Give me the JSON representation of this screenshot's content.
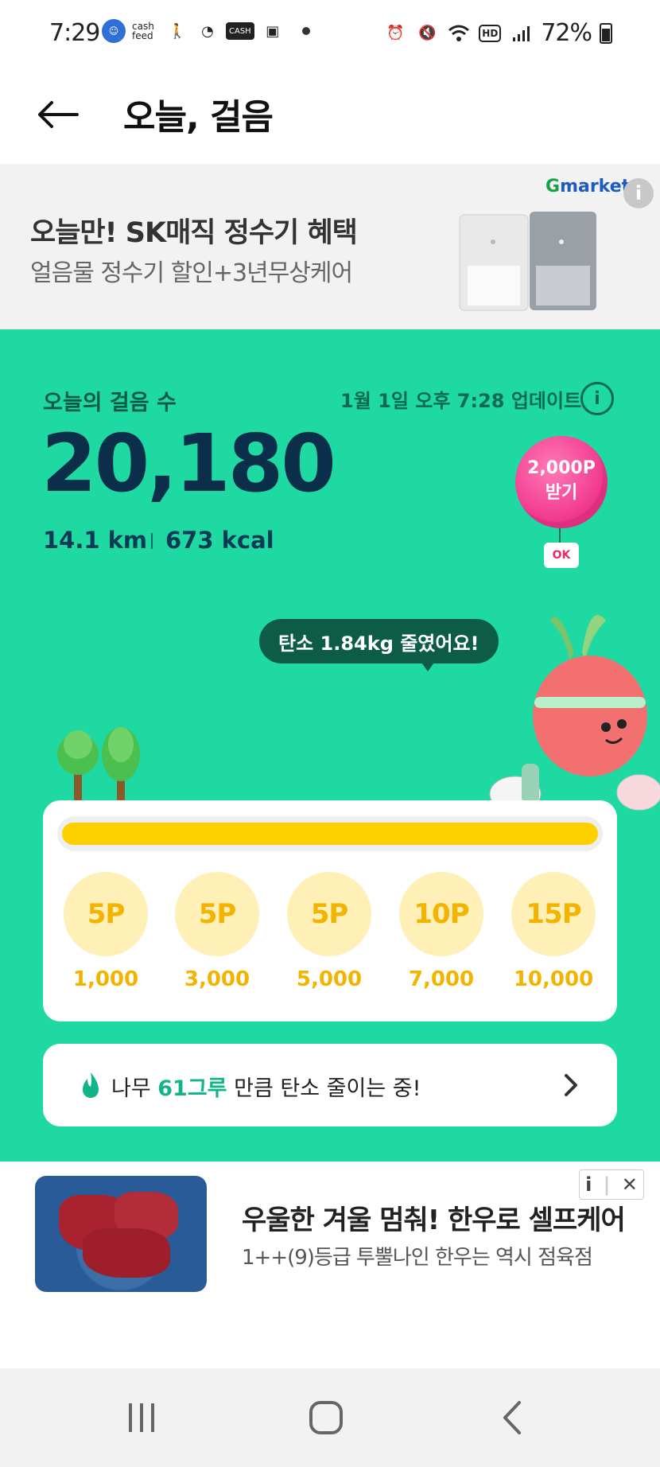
{
  "status_bar": {
    "time": "7:29",
    "cashfeed_text": "cash feed",
    "cash_badge": "CASH",
    "battery": "72%",
    "hd": "HD"
  },
  "header": {
    "title": "오늘, 걸음"
  },
  "ad_top": {
    "brand": "Gmarket",
    "title": "오늘만! SK매직 정수기 혜택",
    "subtitle": "얼음물 정수기 할인+3년무상케어",
    "info": "i"
  },
  "steps": {
    "label": "오늘의 걸음 수",
    "updated": "1월 1일 오후 7:28 업데이트",
    "info": "i",
    "count": "20,180",
    "distance": "14.1 km",
    "kcal": "673 kcal",
    "balloon_amount": "2,000P",
    "balloon_action": "받기",
    "okcash": "OK",
    "speech": "탄소 1.84kg 줄였어요!",
    "progress_fraction": 1.0
  },
  "rewards": [
    {
      "points": "5P",
      "steps": "1,000"
    },
    {
      "points": "5P",
      "steps": "3,000"
    },
    {
      "points": "5P",
      "steps": "5,000"
    },
    {
      "points": "10P",
      "steps": "7,000"
    },
    {
      "points": "15P",
      "steps": "10,000"
    }
  ],
  "carbon": {
    "prefix": "나무 ",
    "highlight": "61그루",
    "suffix": " 만큼 탄소 줄이는 중!"
  },
  "ad_bottom": {
    "title": "우울한 겨울 멈춰! 한우로 셀프케어",
    "subtitle": "1++(9)등급 투뿔나인 한우는 역시 점육점",
    "info": "i",
    "close": "✕"
  },
  "colors": {
    "green": "#1ed9a2",
    "dark_green": "#0c5c46",
    "navy": "#0b2e4a",
    "yellow": "#ffd000",
    "pink": "#f0328a"
  }
}
